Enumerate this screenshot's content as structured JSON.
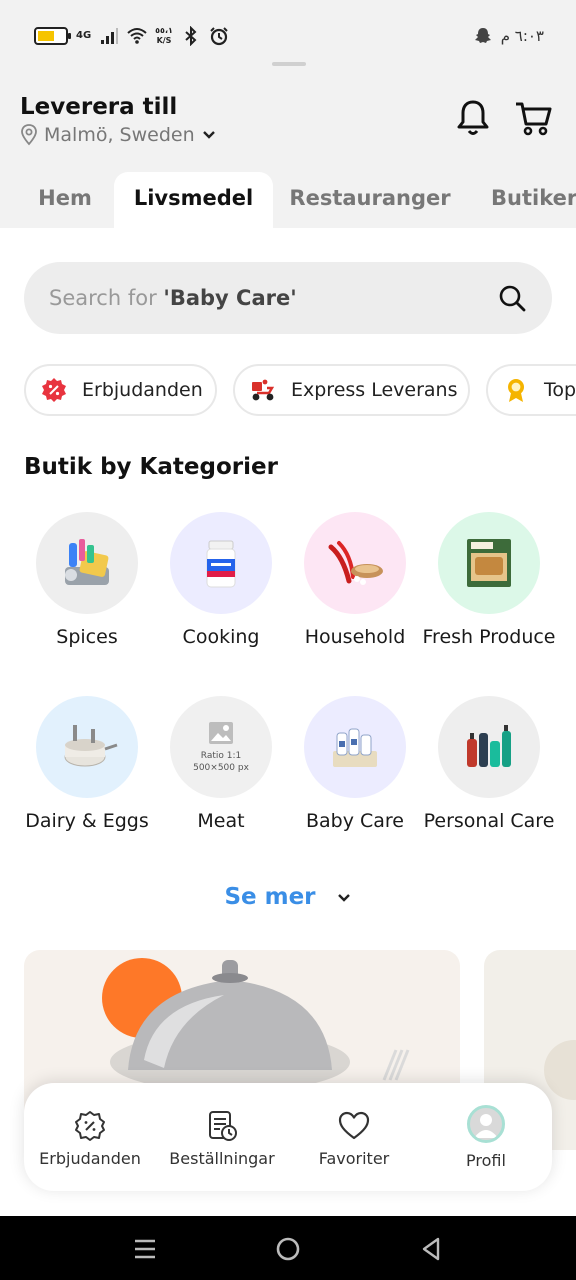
{
  "status_bar": {
    "network": "4G",
    "speed": "٥٥،١",
    "speed_unit": "K/S",
    "time": "٦:٠٣ م",
    "battery_level": 0.6,
    "icons": [
      "battery-icon",
      "signal-icon",
      "wifi-icon",
      "bluetooth-icon",
      "alarm-icon",
      "snapchat-icon"
    ]
  },
  "header": {
    "title": "Leverera till",
    "location": "Malmö, Sweden",
    "icons": [
      "location-pin-icon",
      "chevron-down-icon",
      "bell-icon",
      "cart-icon"
    ]
  },
  "tabs": [
    {
      "label": "Hem",
      "active": false
    },
    {
      "label": "Livsmedel",
      "active": true
    },
    {
      "label": "Restauranger",
      "active": false
    },
    {
      "label": "Butiker",
      "active": false
    }
  ],
  "search": {
    "prefix": "Search for",
    "term": "'Baby Care'",
    "icon": "search-icon"
  },
  "chips": [
    {
      "label": "Erbjudanden",
      "icon": "offer-badge-icon"
    },
    {
      "label": "Express Leverans",
      "icon": "delivery-scooter-icon"
    },
    {
      "label": "Top",
      "icon": "award-ribbon-icon"
    }
  ],
  "section_title": "Butik by Kategorier",
  "categories": [
    {
      "label": "Spices",
      "bg": "#eeeeee",
      "icon": "cleaning-supplies-image"
    },
    {
      "label": "Cooking",
      "bg": "#ececff",
      "icon": "pill-bottle-image"
    },
    {
      "label": "Household",
      "bg": "#fde6f4",
      "icon": "chili-spices-image"
    },
    {
      "label": "Fresh Produce",
      "bg": "#dcf8e8",
      "icon": "frozen-food-box-image"
    },
    {
      "label": "Dairy & Eggs",
      "bg": "#e2f1fd",
      "icon": "cookware-set-image"
    },
    {
      "label": "Meat",
      "bg": "#f0f0f0",
      "icon": "image-placeholder-image",
      "placeholder_ratio": "Ratio 1:1",
      "placeholder_size": "500×500 px"
    },
    {
      "label": "Baby Care",
      "bg": "#ececff",
      "icon": "baby-care-products-image"
    },
    {
      "label": "Personal Care",
      "bg": "#eeeeee",
      "icon": "personal-care-bottles-image"
    }
  ],
  "see_more": "Se mer",
  "bottom_nav": [
    {
      "label": "Erbjudanden",
      "icon": "discount-badge-icon"
    },
    {
      "label": "Beställningar",
      "icon": "orders-clock-icon"
    },
    {
      "label": "Favoriter",
      "icon": "heart-icon"
    },
    {
      "label": "Profil",
      "icon": "profile-avatar-icon"
    }
  ],
  "colors": {
    "accent": "#3a8ee6",
    "header_bg": "#f2f2f2",
    "offer_red": "#e8343f",
    "scooter_red": "#d9302a",
    "award_yellow": "#f5b400"
  }
}
